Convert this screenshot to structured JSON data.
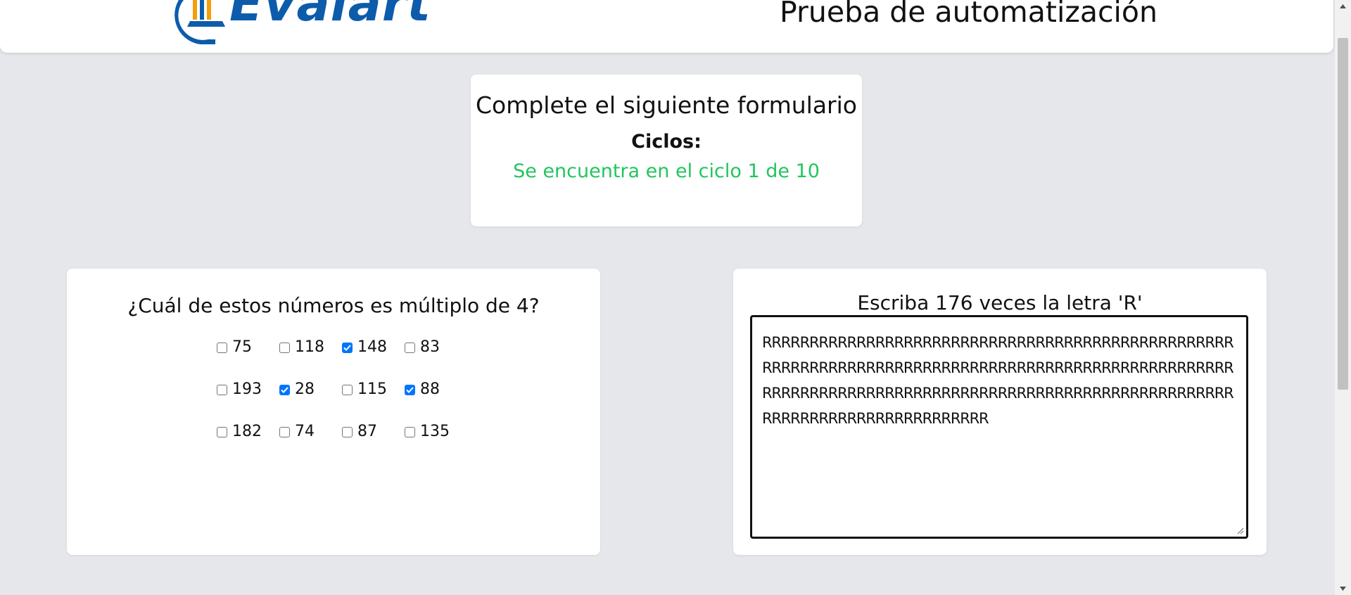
{
  "header": {
    "logo_text": "Evalart",
    "title": "Prueba de automatización"
  },
  "form": {
    "title": "Complete el siguiente formulario",
    "cycles_label": "Ciclos:",
    "cycles_status": "Se encuentra en el ciclo 1 de 10",
    "status_color": "#22c55e"
  },
  "question": {
    "text": "¿Cuál de estos números es múltiplo de 4?",
    "options": [
      {
        "label": "75",
        "checked": false
      },
      {
        "label": "118",
        "checked": false
      },
      {
        "label": "148",
        "checked": true
      },
      {
        "label": "83",
        "checked": false
      },
      {
        "label": "193",
        "checked": false
      },
      {
        "label": "28",
        "checked": true
      },
      {
        "label": "115",
        "checked": false
      },
      {
        "label": "88",
        "checked": true
      },
      {
        "label": "182",
        "checked": false
      },
      {
        "label": "74",
        "checked": false
      },
      {
        "label": "87",
        "checked": false
      },
      {
        "label": "135",
        "checked": false
      }
    ]
  },
  "textarea": {
    "instruction": "Escriba 176 veces la letra 'R'",
    "value": "RRRRRRRRRRRRRRRRRRRRRRRRRRRRRRRRRRRRRRRRRRRRRRRRRRRRRRRRRRRRRRRRRRRRRRRRRRRRRRRRRRRRRRRRRRRRRRRRRRRRRRRRRRRRRRRRRRRRRRRRRRRRRRRRRRRRRRRRRRRRRRRRRRRRRRRRRRRRRRRRRRRRRRRRRRRRRR"
  },
  "colors": {
    "brand": "#0d5cab",
    "checkbox_accent": "#0075ff",
    "page_background": "#e5e7eb"
  }
}
